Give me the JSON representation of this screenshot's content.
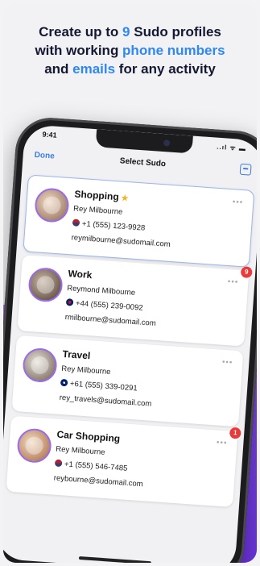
{
  "headline": {
    "line1_prefix": "Create up to ",
    "line1_highlight": "9",
    "line1_suffix": " Sudo profiles",
    "line2_prefix": "with working ",
    "line2_highlight": "phone numbers",
    "line3_prefix": "and ",
    "line3_highlight": "emails",
    "line3_suffix": " for any activity"
  },
  "status_bar": {
    "time": "9:41",
    "icons": "..ıl ᯤ ▬"
  },
  "navbar": {
    "done_label": "Done",
    "title": "Select Sudo"
  },
  "cards": [
    {
      "name": "Shopping",
      "starred": true,
      "person": "Rey Milbourne",
      "flag": "us",
      "phone": "+1 (555) 123-9928",
      "email": "reymilbourne@sudomail.com",
      "badge": ""
    },
    {
      "name": "Work",
      "starred": false,
      "person": "Reymond Milbourne",
      "flag": "uk",
      "phone": "+44 (555) 239-0092",
      "email": "rmilbourne@sudomail.com",
      "badge": "9"
    },
    {
      "name": "Travel",
      "starred": false,
      "person": "Rey Milbourne",
      "flag": "au",
      "phone": "+61 (555) 339-0291",
      "email": "rey_travels@sudomail.com",
      "badge": ""
    },
    {
      "name": "Car Shopping",
      "starred": false,
      "person": "Rey Milbourne",
      "flag": "us",
      "phone": "+1 (555) 546-7485",
      "email": "reybourne@sudomail.com",
      "badge": "1"
    }
  ],
  "colors": {
    "accent_blue": "#2f87f2",
    "purple": "#7e48e6",
    "badge_red": "#e83a3a"
  }
}
